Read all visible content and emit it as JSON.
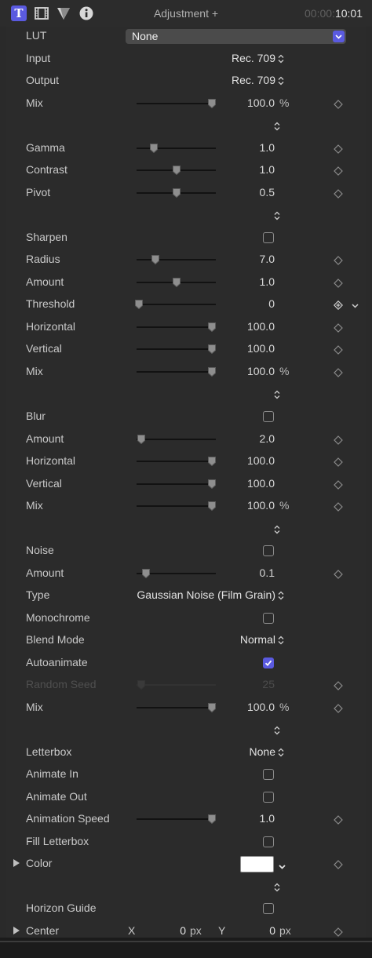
{
  "header": {
    "title": "Adjustment +",
    "timecode_dim": "00:00:",
    "timecode": "10:01",
    "icons": [
      "text-inspector-icon",
      "film-inspector-icon",
      "generator-inspector-icon",
      "info-inspector-icon"
    ],
    "text_icon_glyph": "T",
    "accent": "#5a5ae0"
  },
  "lut": {
    "label": "LUT",
    "value": "None"
  },
  "input": {
    "label": "Input",
    "value": "Rec. 709"
  },
  "output": {
    "label": "Output",
    "value": "Rec. 709"
  },
  "mix1": {
    "label": "Mix",
    "value": "100.0",
    "unit": "%",
    "level": 0.95
  },
  "gamma": {
    "label": "Gamma",
    "value": "1.0",
    "level": 0.22
  },
  "contrast": {
    "label": "Contrast",
    "value": "1.0",
    "level": 0.5
  },
  "pivot": {
    "label": "Pivot",
    "value": "0.5",
    "level": 0.5
  },
  "sharpen": {
    "label": "Sharpen",
    "checked": false
  },
  "radius": {
    "label": "Radius",
    "value": "7.0",
    "level": 0.24
  },
  "amount1": {
    "label": "Amount",
    "value": "1.0",
    "level": 0.5
  },
  "threshold": {
    "label": "Threshold",
    "value": "0",
    "level": 0.03
  },
  "horizontal1": {
    "label": "Horizontal",
    "value": "100.0",
    "level": 0.95
  },
  "vertical1": {
    "label": "Vertical",
    "value": "100.0",
    "level": 0.95
  },
  "mix2": {
    "label": "Mix",
    "value": "100.0",
    "unit": "%",
    "level": 0.95
  },
  "blur": {
    "label": "Blur",
    "checked": false
  },
  "amount2": {
    "label": "Amount",
    "value": "2.0",
    "level": 0.06
  },
  "horizontal2": {
    "label": "Horizontal",
    "value": "100.0",
    "level": 0.95
  },
  "vertical2": {
    "label": "Vertical",
    "value": "100.0",
    "level": 0.95
  },
  "mix3": {
    "label": "Mix",
    "value": "100.0",
    "unit": "%",
    "level": 0.95
  },
  "noise": {
    "label": "Noise",
    "checked": false
  },
  "amount3": {
    "label": "Amount",
    "value": "0.1",
    "level": 0.12
  },
  "type": {
    "label": "Type",
    "value": "Gaussian Noise (Film Grain)"
  },
  "monochrome": {
    "label": "Monochrome",
    "checked": false
  },
  "blend_mode": {
    "label": "Blend Mode",
    "value": "Normal"
  },
  "autoanimate": {
    "label": "Autoanimate",
    "checked": true
  },
  "random_seed": {
    "label": "Random Seed",
    "value": "25",
    "level": 0.06
  },
  "mix4": {
    "label": "Mix",
    "value": "100.0",
    "unit": "%",
    "level": 0.95
  },
  "letterbox": {
    "label": "Letterbox",
    "value": "None"
  },
  "animate_in": {
    "label": "Animate In",
    "checked": false
  },
  "animate_out": {
    "label": "Animate Out",
    "checked": false
  },
  "animation_speed": {
    "label": "Animation Speed",
    "value": "1.0",
    "level": 0.95
  },
  "fill_letterbox": {
    "label": "Fill Letterbox",
    "checked": false
  },
  "color": {
    "label": "Color",
    "swatch": "#ffffff"
  },
  "horizon_guide": {
    "label": "Horizon Guide",
    "checked": false
  },
  "center": {
    "label": "Center",
    "x_label": "X",
    "x_value": "0",
    "y_label": "Y",
    "y_value": "0",
    "unit": "px"
  }
}
